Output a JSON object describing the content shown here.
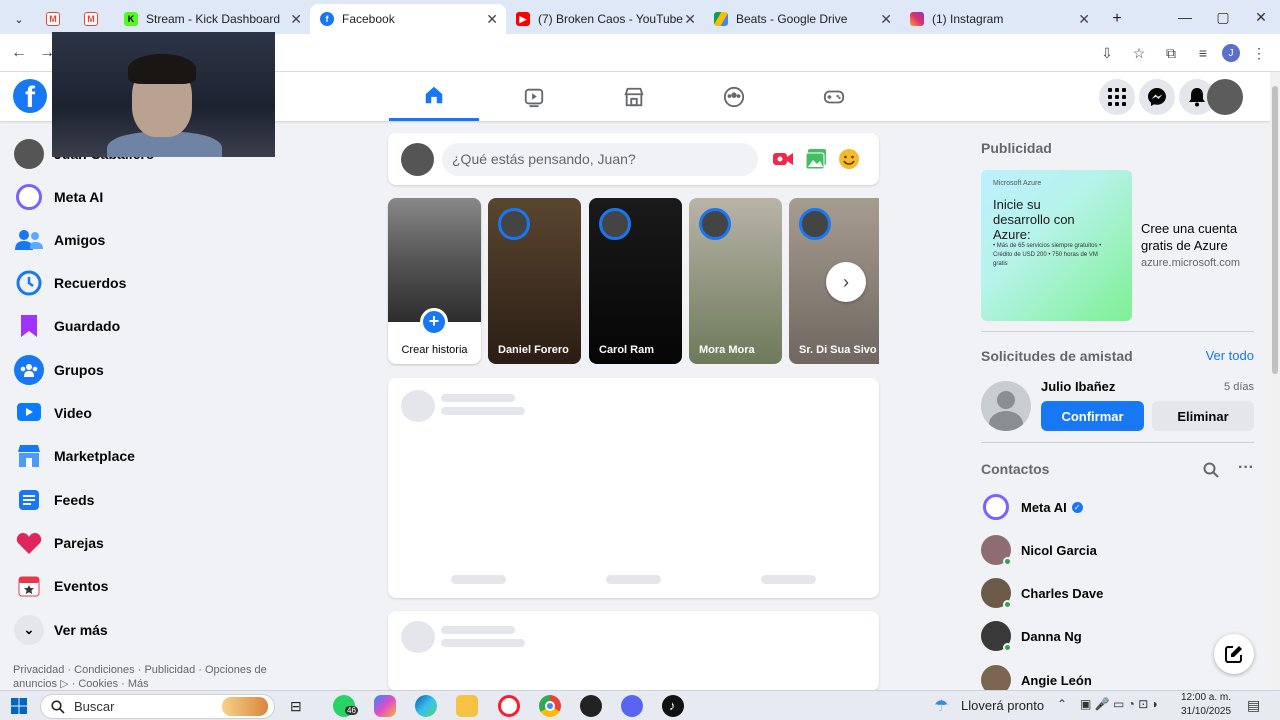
{
  "browser": {
    "tabs": [
      {
        "label": "",
        "icon": "gmail-icon",
        "color": "#ea4335"
      },
      {
        "label": "",
        "icon": "gmail-icon",
        "color": "#ea4335"
      },
      {
        "label": "Stream - Kick Dashboard",
        "icon": "kick-icon",
        "color": "#53fc18"
      },
      {
        "label": "Facebook",
        "icon": "facebook-icon",
        "color": "#1877f2",
        "active": true
      },
      {
        "label": "(7) Broken Caos - YouTube",
        "icon": "youtube-icon",
        "color": "#ff0000"
      },
      {
        "label": "Beats - Google Drive",
        "icon": "drive-icon",
        "color": "#fbbc04"
      },
      {
        "label": "(1) Instagram",
        "icon": "instagram-icon",
        "color": "#e1306c"
      }
    ],
    "profile_initial": "J"
  },
  "facebook": {
    "user_name": "Juan Caballero",
    "sidebar": [
      {
        "label": "Meta AI",
        "icon": "meta-ai-icon",
        "color": "#7b61ff"
      },
      {
        "label": "Amigos",
        "icon": "friends-icon",
        "color": "#1877f2"
      },
      {
        "label": "Recuerdos",
        "icon": "memories-icon",
        "color": "#1877f2"
      },
      {
        "label": "Guardado",
        "icon": "saved-icon",
        "color": "#a033ff"
      },
      {
        "label": "Grupos",
        "icon": "groups-icon",
        "color": "#1877f2"
      },
      {
        "label": "Video",
        "icon": "video-icon",
        "color": "#0a7cff"
      },
      {
        "label": "Marketplace",
        "icon": "marketplace-icon",
        "color": "#1877f2"
      },
      {
        "label": "Feeds",
        "icon": "feeds-icon",
        "color": "#1877f2"
      },
      {
        "label": "Parejas",
        "icon": "dating-icon",
        "color": "#e0245e"
      },
      {
        "label": "Eventos",
        "icon": "events-icon",
        "color": "#e8364a"
      },
      {
        "label": "Ver más",
        "icon": "chevron-down-icon",
        "color": "#050505"
      }
    ],
    "footer": "Privacidad · Condiciones · Publicidad · Opciones de anuncios ▷ · Cookies · Más",
    "composer_placeholder": "¿Qué estás pensando, Juan?",
    "stories": {
      "create_label": "Crear historia",
      "items": [
        {
          "name": "Daniel Forero",
          "bg": "#3a2a1e"
        },
        {
          "name": "Carol Ram",
          "bg": "#111111"
        },
        {
          "name": "Mora Mora",
          "bg": "#7c8c6a"
        },
        {
          "name": "Sr. Di Sua Sivo",
          "bg": "#9a8e84"
        }
      ]
    },
    "ads": {
      "heading": "Publicidad",
      "brand_small": "Microsoft Azure",
      "img_title": "Inicie su desarrollo con Azure:",
      "img_bullets": "• Más de 65 servicios siempre gratuitos • Crédito de USD 200 • 750 horas de VM gratis",
      "title": "Cree una cuenta gratis de Azure",
      "domain": "azure.microsoft.com"
    },
    "friend_requests": {
      "heading": "Solicitudes de amistad",
      "see_all": "Ver todo",
      "name": "Julio Ibañez",
      "time": "5 días",
      "confirm": "Confirmar",
      "delete": "Eliminar"
    },
    "contacts": {
      "heading": "Contactos",
      "items": [
        {
          "name": "Meta AI",
          "color": "#7b61ff"
        },
        {
          "name": "Nicol Garcia",
          "color": "#8d6c72"
        },
        {
          "name": "Charles Dave",
          "color": "#6d5b4a"
        },
        {
          "name": "Danna Ng",
          "color": "#3a3a3a"
        },
        {
          "name": "Angie León",
          "color": "#7a6650"
        }
      ]
    }
  },
  "taskbar": {
    "search": "Buscar",
    "weather": "Lloverá pronto",
    "time": "12:00 a. m.",
    "date": "31/10/2025",
    "whatsapp_badge": "46"
  }
}
